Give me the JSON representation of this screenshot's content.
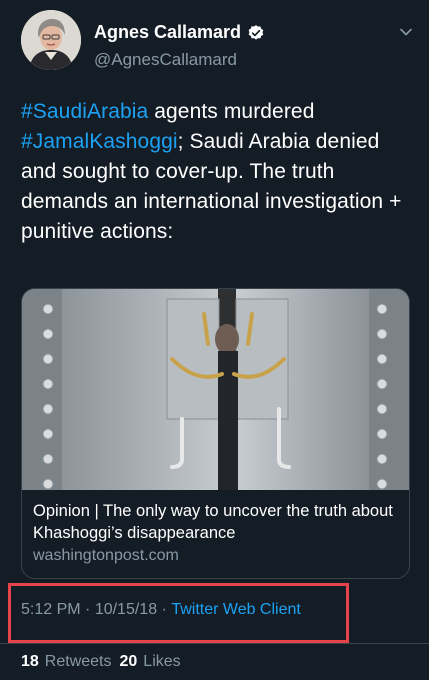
{
  "user": {
    "display_name": "Agnes Callamard",
    "handle": "@AgnesCallamard"
  },
  "tweet": {
    "hashtag1": "#SaudiArabia",
    "text1": " agents murdered ",
    "hashtag2": "#JamalKashoggi",
    "text2": "; Saudi Arabia denied and sought to cover-up. The truth demands an international investigation + punitive actions:"
  },
  "card": {
    "title": "Opinion | The only way to uncover the truth about Khashoggi’s disappearance",
    "domain": "washingtonpost.com"
  },
  "meta": {
    "time": "5:12 PM",
    "separator1": " · ",
    "date": "10/15/18",
    "separator2": " · ",
    "source": "Twitter Web Client"
  },
  "stats": {
    "retweets_count": "18",
    "retweets_label": "Retweets",
    "likes_count": "20",
    "likes_label": "Likes"
  },
  "colors": {
    "background": "#141d26",
    "accent": "#1da1f2",
    "secondary_text": "#8899a6",
    "highlight_box": "#e8424b"
  },
  "icons": {
    "verified": "verified-badge-icon",
    "menu": "chevron-down-icon"
  }
}
